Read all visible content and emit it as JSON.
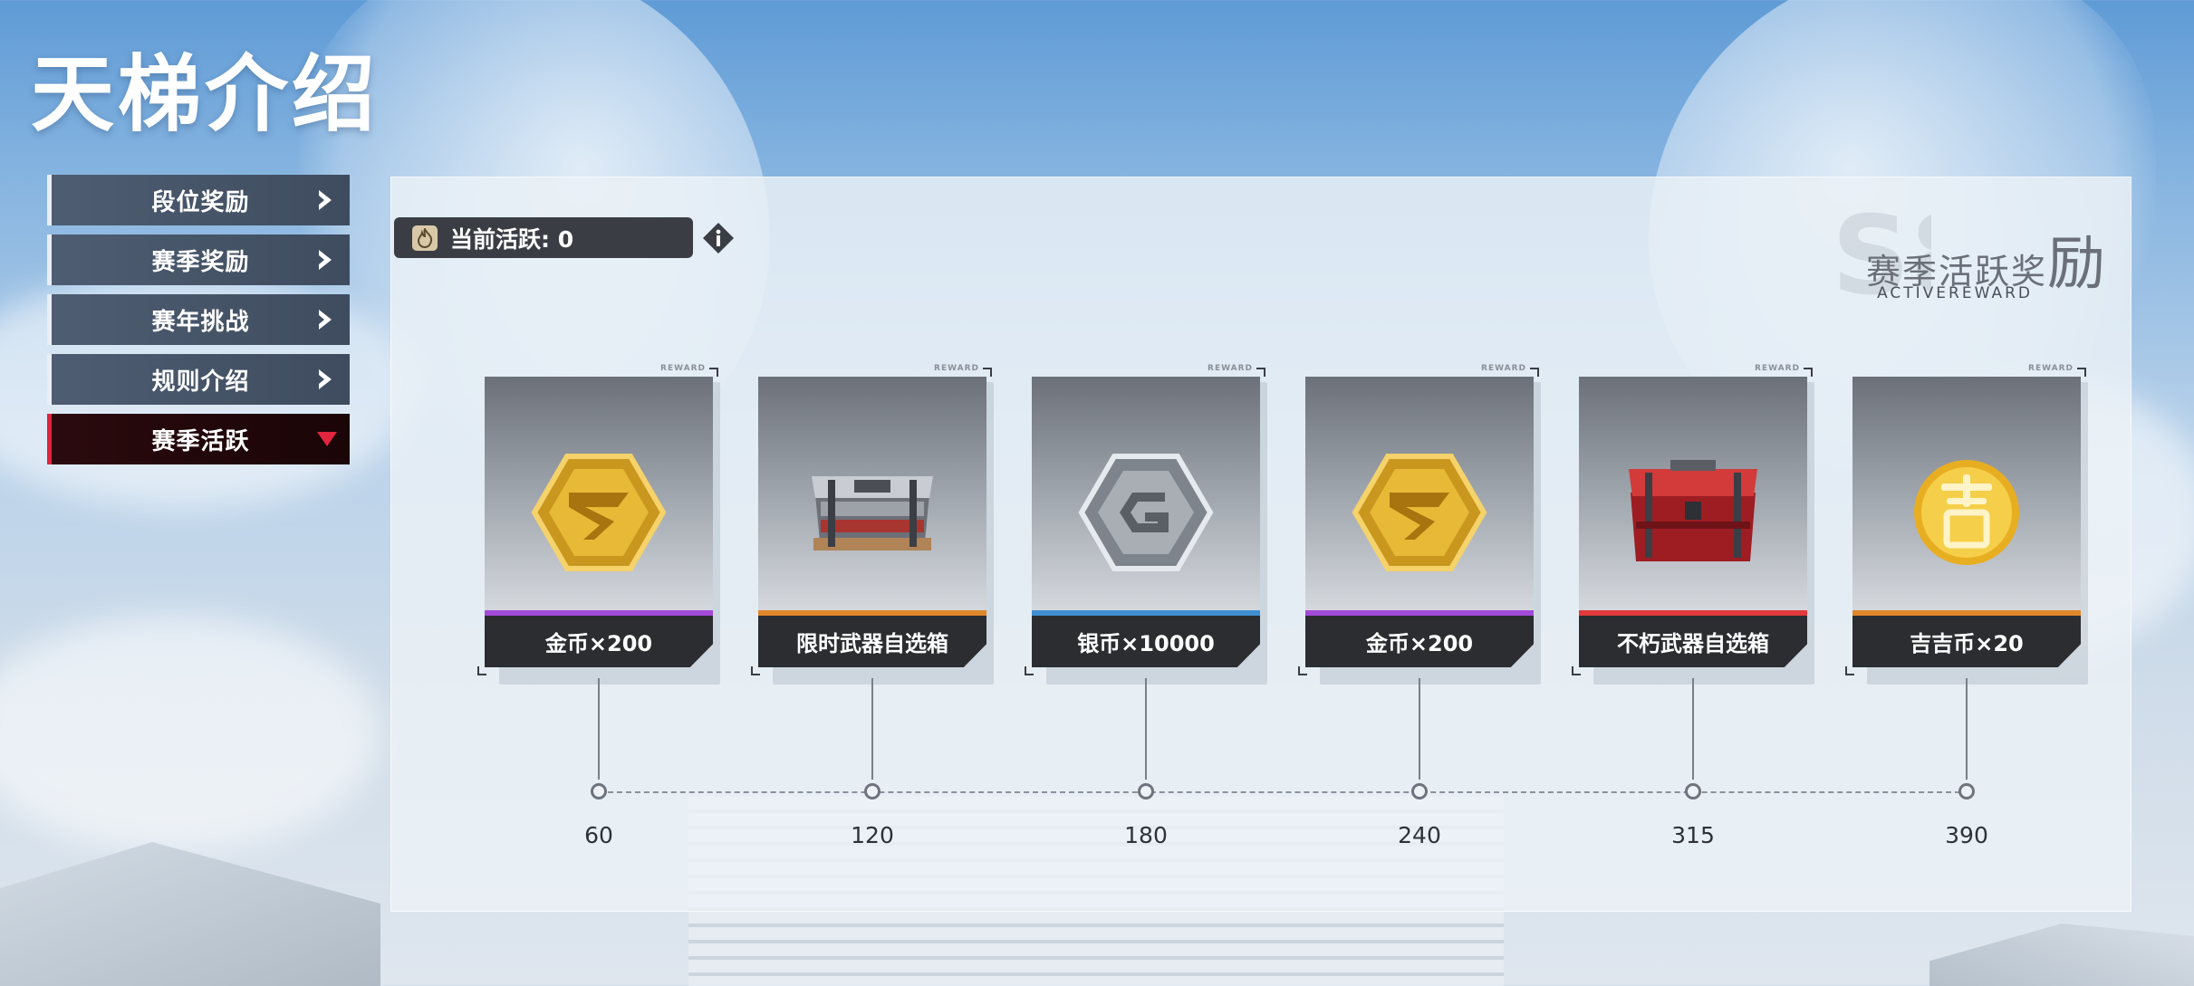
{
  "page": {
    "title": "天梯介绍"
  },
  "menu": {
    "items": [
      {
        "label": "段位奖励",
        "icon": "chevron-right-icon",
        "active": false
      },
      {
        "label": "赛季奖励",
        "icon": "chevron-right-icon",
        "active": false
      },
      {
        "label": "赛年挑战",
        "icon": "chevron-right-icon",
        "active": false
      },
      {
        "label": "规则介绍",
        "icon": "chevron-right-icon",
        "active": false
      },
      {
        "label": "赛季活跃",
        "icon": "chevron-down-icon",
        "active": true
      }
    ]
  },
  "panel": {
    "activity_label": "当前活跃: 0",
    "heading_cn_main": "赛季活跃奖",
    "heading_cn_last": "励",
    "heading_en": "ACTIVEREWARD",
    "card_tag": "REWARD"
  },
  "rewards": [
    {
      "name": "金币×200",
      "threshold": "60",
      "icon": "gold-coin-icon",
      "strip_color": "#a24ad8"
    },
    {
      "name": "限时武器自选箱",
      "threshold": "120",
      "icon": "weapon-crate-icon",
      "strip_color": "#e0872b"
    },
    {
      "name": "银币×10000",
      "threshold": "180",
      "icon": "silver-coin-icon",
      "strip_color": "#3f8fd0"
    },
    {
      "name": "金币×200",
      "threshold": "240",
      "icon": "gold-coin-icon",
      "strip_color": "#a24ad8"
    },
    {
      "name": "不朽武器自选箱",
      "threshold": "315",
      "icon": "red-weapon-crate-icon",
      "strip_color": "#e03a3a"
    },
    {
      "name": "吉吉币×20",
      "threshold": "390",
      "icon": "jiji-coin-icon",
      "strip_color": "#e0872b"
    }
  ],
  "colors": {
    "menu_active_accent": "#e0253e",
    "menu_bg": "#4e5d72",
    "label_bg": "#2b2d31"
  }
}
